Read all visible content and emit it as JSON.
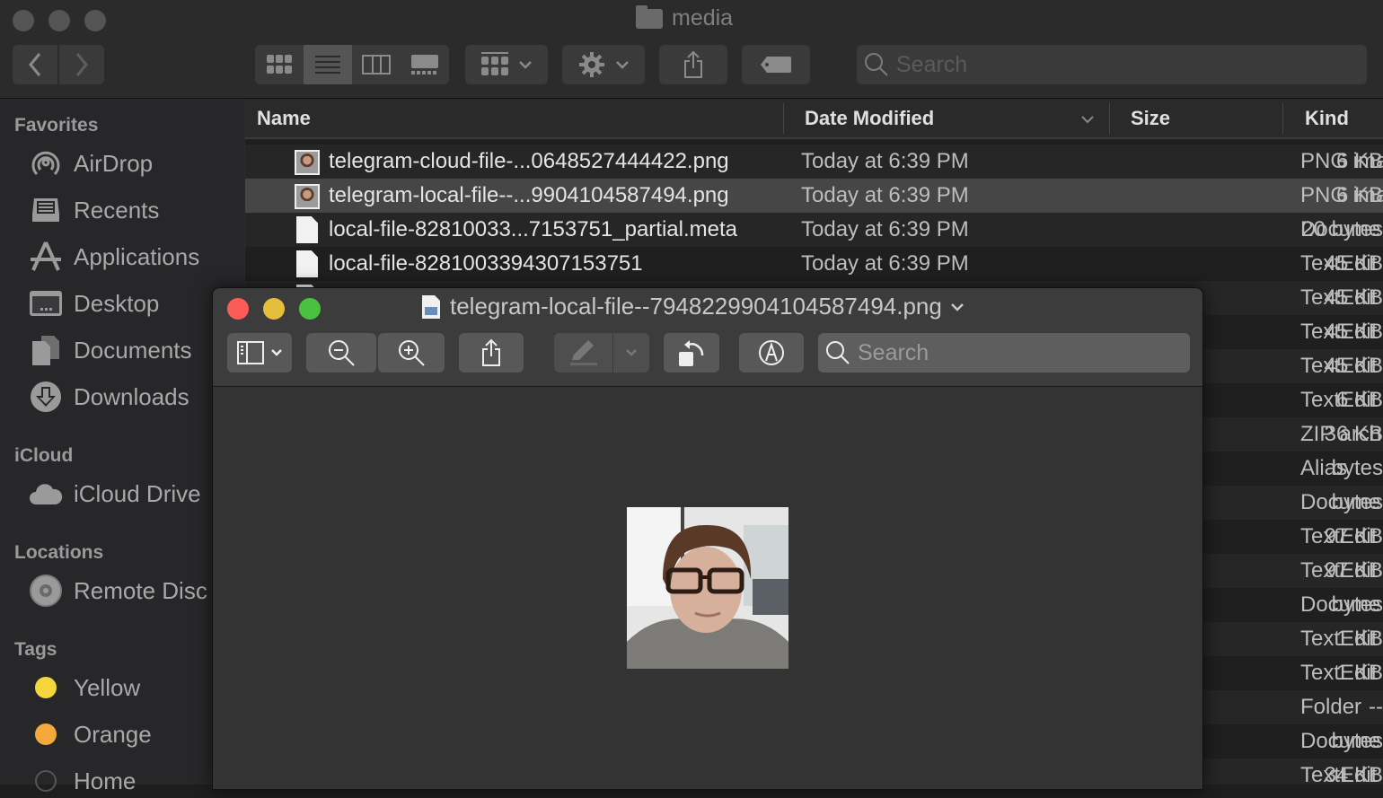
{
  "finder": {
    "window_title": "media",
    "toolbar": {
      "back_icon": "chevron-left-icon",
      "forward_icon": "chevron-right-icon",
      "view_modes": [
        "icon-view",
        "list-view",
        "column-view",
        "gallery-view"
      ],
      "active_view": "list-view",
      "search_placeholder": "Search"
    },
    "sidebar": {
      "sections": [
        {
          "title": "Favorites",
          "items": [
            {
              "label": "AirDrop",
              "icon": "airdrop-icon"
            },
            {
              "label": "Recents",
              "icon": "recents-icon"
            },
            {
              "label": "Applications",
              "icon": "applications-icon"
            },
            {
              "label": "Desktop",
              "icon": "desktop-icon"
            },
            {
              "label": "Documents",
              "icon": "documents-icon"
            },
            {
              "label": "Downloads",
              "icon": "downloads-icon"
            }
          ]
        },
        {
          "title": "iCloud",
          "items": [
            {
              "label": "iCloud Drive",
              "icon": "cloud-icon"
            }
          ]
        },
        {
          "title": "Locations",
          "items": [
            {
              "label": "Remote Disc",
              "icon": "disc-icon"
            }
          ]
        },
        {
          "title": "Tags",
          "items": [
            {
              "label": "Yellow",
              "color": "#f5d63d"
            },
            {
              "label": "Orange",
              "color": "#f5a83b"
            },
            {
              "label": "Home",
              "color": "#555555"
            }
          ]
        }
      ]
    },
    "list": {
      "columns": {
        "name": "Name",
        "date": "Date Modified",
        "size": "Size",
        "kind": "Kind"
      },
      "rows": [
        {
          "name": "telegram-cloud-file-...0648527444422.png",
          "date": "Today at 6:39 PM",
          "size": "6 KB",
          "kind": "PNG ima",
          "icon": "image",
          "selected": false
        },
        {
          "name": "telegram-local-file--...9904104587494.png",
          "date": "Today at 6:39 PM",
          "size": "6 KB",
          "kind": "PNG ima",
          "icon": "image",
          "selected": true
        },
        {
          "name": "local-file-82810033...7153751_partial.meta",
          "date": "Today at 6:39 PM",
          "size": "20 bytes",
          "kind": "Docume",
          "icon": "doc",
          "selected": false
        },
        {
          "name": "local-file-8281003394307153751",
          "date": "Today at 6:39 PM",
          "size": "45 KB",
          "kind": "TextEdit",
          "icon": "doc",
          "selected": false
        },
        {
          "name": "",
          "date": "",
          "size": "45 KB",
          "kind": "TextEdit",
          "icon": "doc",
          "selected": false
        },
        {
          "name": "",
          "date": "",
          "size": "45 KB",
          "kind": "TextEdit",
          "icon": "",
          "selected": false
        },
        {
          "name": "",
          "date": "",
          "size": "45 KB",
          "kind": "TextEdit",
          "icon": "",
          "selected": false
        },
        {
          "name": "",
          "date": "",
          "size": "6 KB",
          "kind": "TextEdit",
          "icon": "",
          "selected": false
        },
        {
          "name": "",
          "date": "",
          "size": "36 KB",
          "kind": "ZIP arch",
          "icon": "",
          "selected": false
        },
        {
          "name": "",
          "date": "",
          "size": "bytes",
          "kind": "Alias",
          "icon": "",
          "selected": false
        },
        {
          "name": "",
          "date": "",
          "size": "bytes",
          "kind": "Docume",
          "icon": "",
          "selected": false
        },
        {
          "name": "",
          "date": "",
          "size": "97 KB",
          "kind": "TextEdit",
          "icon": "",
          "selected": false
        },
        {
          "name": "",
          "date": "",
          "size": "97 KB",
          "kind": "TextEdit",
          "icon": "",
          "selected": false
        },
        {
          "name": "",
          "date": "",
          "size": "bytes",
          "kind": "Docume",
          "icon": "",
          "selected": false
        },
        {
          "name": "",
          "date": "",
          "size": "1 KB",
          "kind": "TextEdit",
          "icon": "",
          "selected": false
        },
        {
          "name": "",
          "date": "",
          "size": "1 KB",
          "kind": "TextEdit",
          "icon": "",
          "selected": false
        },
        {
          "name": "",
          "date": "",
          "size": "--",
          "kind": "Folder",
          "icon": "",
          "selected": false
        },
        {
          "name": "",
          "date": "",
          "size": "bytes",
          "kind": "Docume",
          "icon": "",
          "selected": false
        },
        {
          "name": "",
          "date": "",
          "size": "34 KB",
          "kind": "TextEdit",
          "icon": "",
          "selected": false
        }
      ]
    }
  },
  "preview": {
    "title": "telegram-local-file--7948229904104587494.png",
    "title_chevron": "⌄",
    "traffic": {
      "close": "#fc5b57",
      "minimize": "#e5bf3c",
      "zoom": "#4ac23f"
    },
    "search_placeholder": "Search",
    "toolbar_icons": [
      "sidebar-icon",
      "zoom-out-icon",
      "zoom-in-icon",
      "share-icon",
      "highlight-icon",
      "rotate-icon",
      "markup-icon"
    ]
  }
}
